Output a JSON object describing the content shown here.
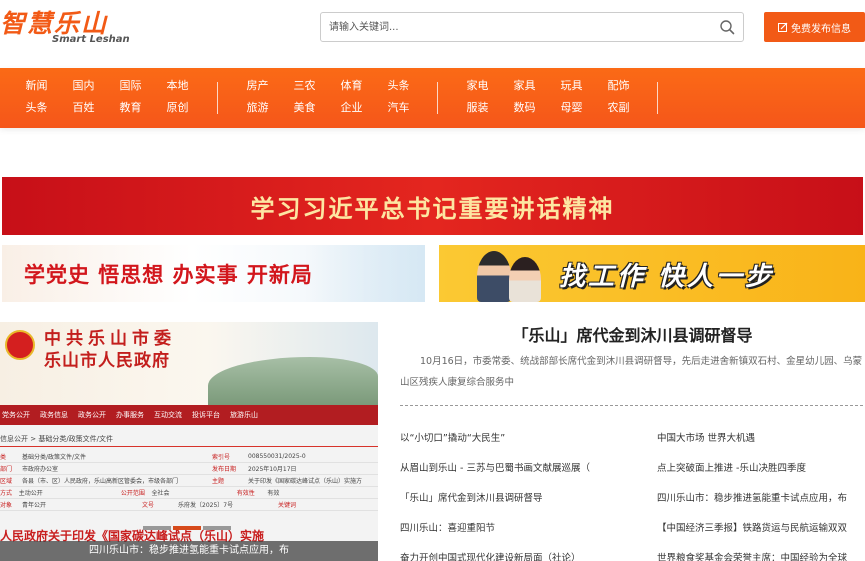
{
  "header": {
    "logo_cn": "智慧乐山",
    "logo_en": "Smart Leshan",
    "search_placeholder": "请输入关键词...",
    "publish_label": "免费发布信息"
  },
  "nav": {
    "groups": [
      [
        "新闻",
        "国内",
        "国际",
        "本地",
        "头条",
        "百姓",
        "教育",
        "原创"
      ],
      [
        "房产",
        "三农",
        "体育",
        "头条",
        "旅游",
        "美食",
        "企业",
        "汽车"
      ],
      [
        "家电",
        "家具",
        "玩具",
        "配饰",
        "服装",
        "数码",
        "母婴",
        "农副"
      ]
    ]
  },
  "banners": {
    "main": "学习习近平总书记重要讲话精神",
    "party": "学党史  悟思想  办实事  开新局",
    "job": "找工作 快人一步"
  },
  "gov_image": {
    "title1": "中共乐山市委",
    "title2": "乐山市人民政府",
    "nav": [
      "党务公开",
      "政务信息",
      "政务公开",
      "办事服务",
      "互动交流",
      "投诉平台",
      "旅游乐山"
    ],
    "crumb": "信息公开 > 基础分类/政策文件/文件",
    "rows": [
      [
        "类",
        "基础分类/政策文件/文件",
        "索引号",
        "008550031/2025-0"
      ],
      [
        "部门",
        "市政府办公室",
        "发布日期",
        "2025年10月17日"
      ],
      [
        "区域",
        "各县（市、区）人民政府，乐山高新区管委会，市级各部门",
        "主题",
        "关于印发《国家碳达峰试点（乐山）实施方"
      ],
      [
        "方式",
        "主动公开",
        "公开范围",
        "全社会"
      ],
      [
        "对象",
        "青年公开",
        "文号",
        "乐府发〔2025〕7号"
      ]
    ],
    "row_extra": [
      "有效性",
      "有效",
      "关键词"
    ],
    "doc_title": "人民政府关于印发《国家碳达峰试点（乐山）实施",
    "caption": "四川乐山市：稳步推进氢能重卡试点应用，布"
  },
  "article": {
    "title": "「乐山」席代金到沐川县调研督导",
    "summary": "10月16日，市委常委、统战部部长席代金到沐川县调研督导，先后走进舍新镇双石村、金星幼儿园、乌蒙山区残疾人康复综合服务中"
  },
  "news_left": [
    "以“小切口”撬动“大民生”",
    "从眉山到乐山 - 三苏与巴蜀书画文献展巡展（",
    "「乐山」席代金到沐川县调研督导",
    "四川乐山：喜迎重阳节",
    "奋力开创中国式现代化建设新局面（社论）"
  ],
  "news_right": [
    "中国大市场 世界大机遇",
    "点上突破面上推进 -乐山决胜四季度",
    "四川乐山市：稳步推进氢能重卡试点应用，布",
    "【中国经济三季报】铁路货运与民航运输双双",
    "世界粮食奖基金会荣誉主席：中国经验为全球"
  ],
  "colors": {
    "brand": "#f25a16",
    "nav": "#f8601a",
    "banner_red": "#d2161c",
    "banner_gold": "#fbc933"
  }
}
